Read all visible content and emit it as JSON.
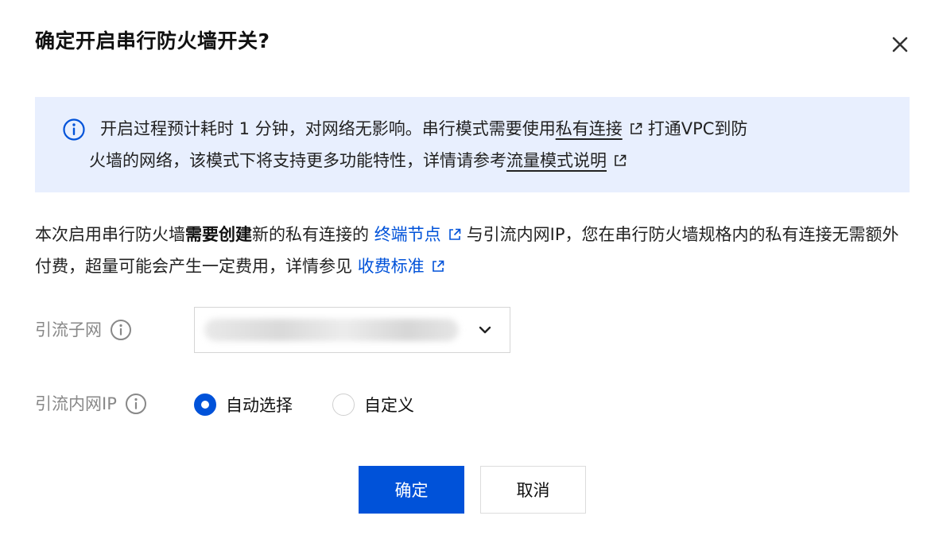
{
  "dialog": {
    "title": "确定开启串行防火墙开关?"
  },
  "banner": {
    "text_1": "开启过程预计耗时 1 分钟，对网络无影响。串行模式需要使用",
    "link_1": "私有连接",
    "text_2": "打通VPC到防",
    "text_3": "火墙的网络，该模式下将支持更多功能特性，详情请参考",
    "link_2": "流量模式说明"
  },
  "paragraph": {
    "text_1": "本次启用串行防火墙",
    "bold": "需要创建",
    "text_2": "新的私有连接的 ",
    "link_1": "终端节点",
    "text_3": "与引流内网IP，您在串行防火墙规格内的私有连接无需额外付费，超量可能会产生一定费用，详情参见 ",
    "link_2": "收费标准"
  },
  "form": {
    "subnet_label": "引流子网",
    "subnet_value": "",
    "ip_label": "引流内网IP",
    "ip_options": [
      {
        "label": "自动选择",
        "selected": true
      },
      {
        "label": "自定义",
        "selected": false
      }
    ]
  },
  "footer": {
    "confirm_label": "确定",
    "cancel_label": "取消"
  },
  "colors": {
    "accent": "#0052d9",
    "banner_bg": "#e8effe"
  },
  "icons": [
    "close-icon",
    "info-circle-icon",
    "external-link-icon",
    "chevron-down-icon"
  ]
}
